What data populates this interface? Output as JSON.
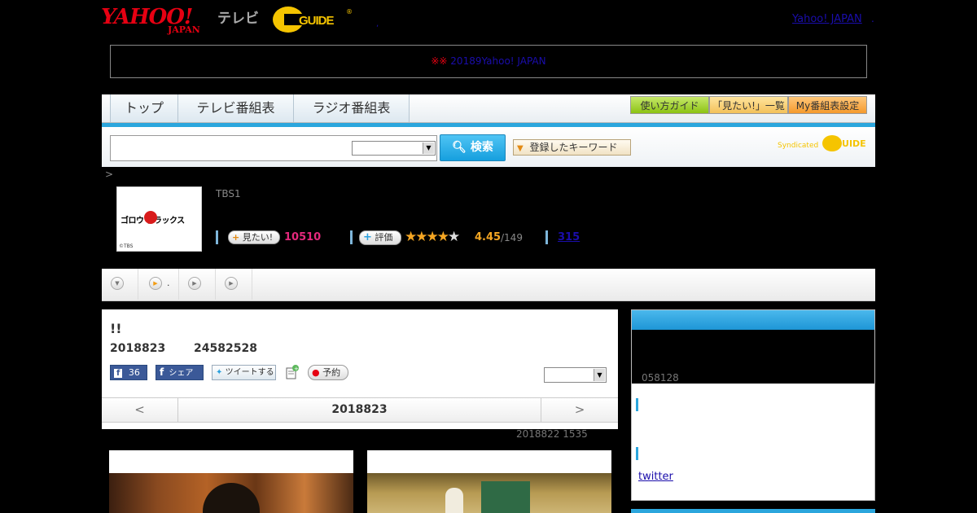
{
  "header": {
    "yahoo_logo": "YAHOO!",
    "yahoo_sub": "JAPAN",
    "tv_label": "テレビ",
    "gguide_logo": "GUIDE",
    "gguide_reg": "®",
    "dot": ",",
    "yahoo_link": "Yahoo! JAPAN",
    "trailing_dot": "."
  },
  "notice": {
    "mark": "※※",
    "text": "2018",
    "link": "9Yahoo! JAPAN　　　　"
  },
  "nav": {
    "tabs": [
      "トップ",
      "テレビ番組表",
      "ラジオ番組表"
    ],
    "buttons": [
      "使い方ガイド",
      "「見たい!」一覧",
      "My番組表設定"
    ]
  },
  "search": {
    "value": "",
    "select_value": "",
    "button": "検索",
    "keyword_button": "登録したキーワード",
    "syndicated": "Syndicated",
    "gguide_small": "GUIDE"
  },
  "breadcrumb": ">",
  "program": {
    "thumb_logo": "ゴロウ デラックス",
    "thumb_copyright": "©TBS",
    "channel": "TBS1",
    "mitai_label": "見たい!",
    "mitai_count": "10510",
    "hyoka_label": "評価",
    "stars_filled": "★★★★",
    "stars_empty": "★",
    "rating": "4.45",
    "rating_total": "/149",
    "review_count": "315"
  },
  "tabrow": {
    "items": [
      {
        "icon": "▼",
        "label": ""
      },
      {
        "icon": "▶",
        "label": "."
      },
      {
        "icon": "▶",
        "label": ""
      },
      {
        "icon": "▶",
        "label": ""
      }
    ]
  },
  "episode": {
    "title": "!!",
    "date": "2018823",
    "time": "24582528",
    "fb_count": "36",
    "fb_share": "シェア",
    "tweet": "ツイートする",
    "reserve": "予約",
    "select_value": ""
  },
  "date_nav": {
    "prev": "<",
    "current": "2018823",
    "next": ">"
  },
  "updated": "2018822  1535",
  "sidebar": {
    "sub": "058128",
    "twitter": "twitter"
  },
  "colors": {
    "accent_blue": "#2ba6dd",
    "pink": "#e4287c",
    "star": "#f5a623",
    "yahoo_red": "#e60012"
  }
}
